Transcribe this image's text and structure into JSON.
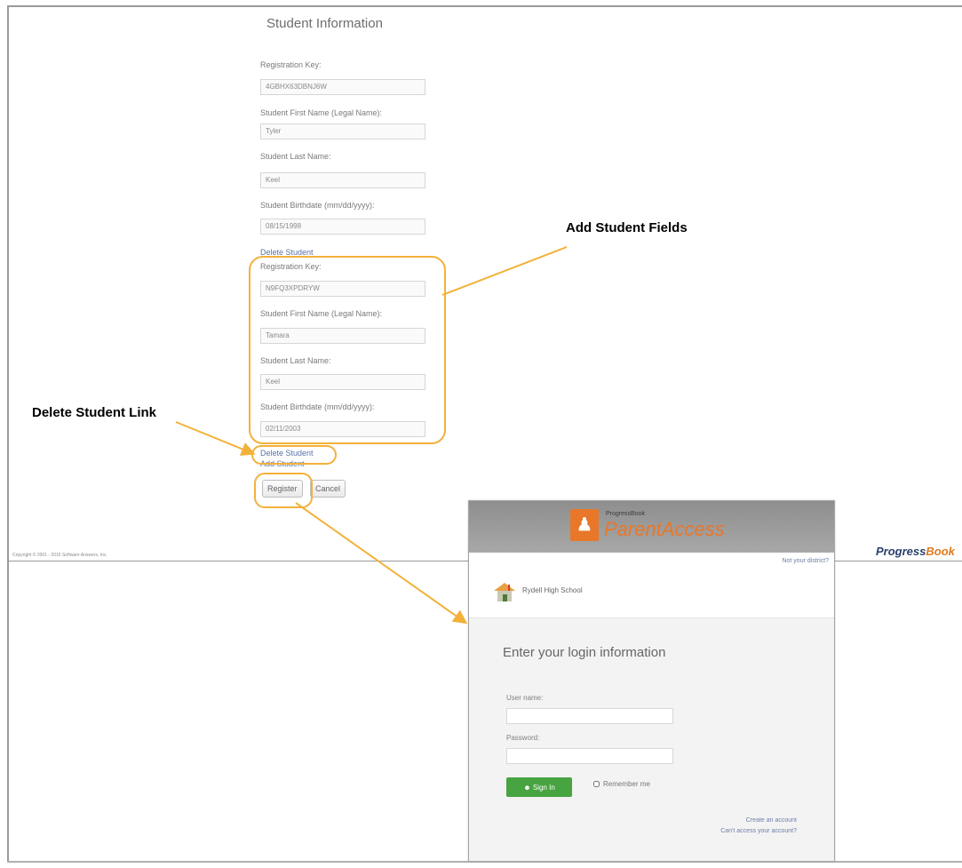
{
  "form": {
    "title": "Student Information",
    "student1": {
      "reg_key_label": "Registration Key:",
      "reg_key_value": "4GBHX63DBNJ6W",
      "first_name_label": "Student First Name (Legal Name):",
      "first_name_value": "Tyler",
      "last_name_label": "Student Last Name:",
      "last_name_value": "Keel",
      "birthdate_label": "Student Birthdate (mm/dd/yyyy):",
      "birthdate_value": "08/15/1998"
    },
    "delete_link_1": "Delete Student",
    "student2": {
      "reg_key_label": "Registration Key:",
      "reg_key_value": "N9FQ3XPDRYW",
      "first_name_label": "Student First Name (Legal Name):",
      "first_name_value": "Tamara",
      "last_name_label": "Student Last Name:",
      "last_name_value": "Keel",
      "birthdate_label": "Student Birthdate (mm/dd/yyyy):",
      "birthdate_value": "02/11/2003"
    },
    "delete_link_2": "Delete Student",
    "add_link": "Add Student",
    "register_button": "Register",
    "cancel_button": "Cancel"
  },
  "annotations": {
    "add_student_fields": "Add Student Fields",
    "delete_student_link": "Delete Student Link",
    "color": "#f3b13a"
  },
  "footer": {
    "copyright": "Copyright © 2001 - 2015 Software Answers, Inc.",
    "logo_part1": "Progress",
    "logo_part2": "Book"
  },
  "login": {
    "brand_small": "ProgressBook",
    "brand_big": "ParentAccess",
    "find_district": "Not your district?",
    "school_name": "Rydell High School",
    "title": "Enter your login information",
    "username_label": "User name:",
    "password_label": "Password:",
    "signin_button": "Sign In",
    "remember_me": "Remember me",
    "create_account": "Create an account",
    "cant_access": "Can't access your account?",
    "brand_color": "#e8772a",
    "button_color": "#48a341"
  }
}
